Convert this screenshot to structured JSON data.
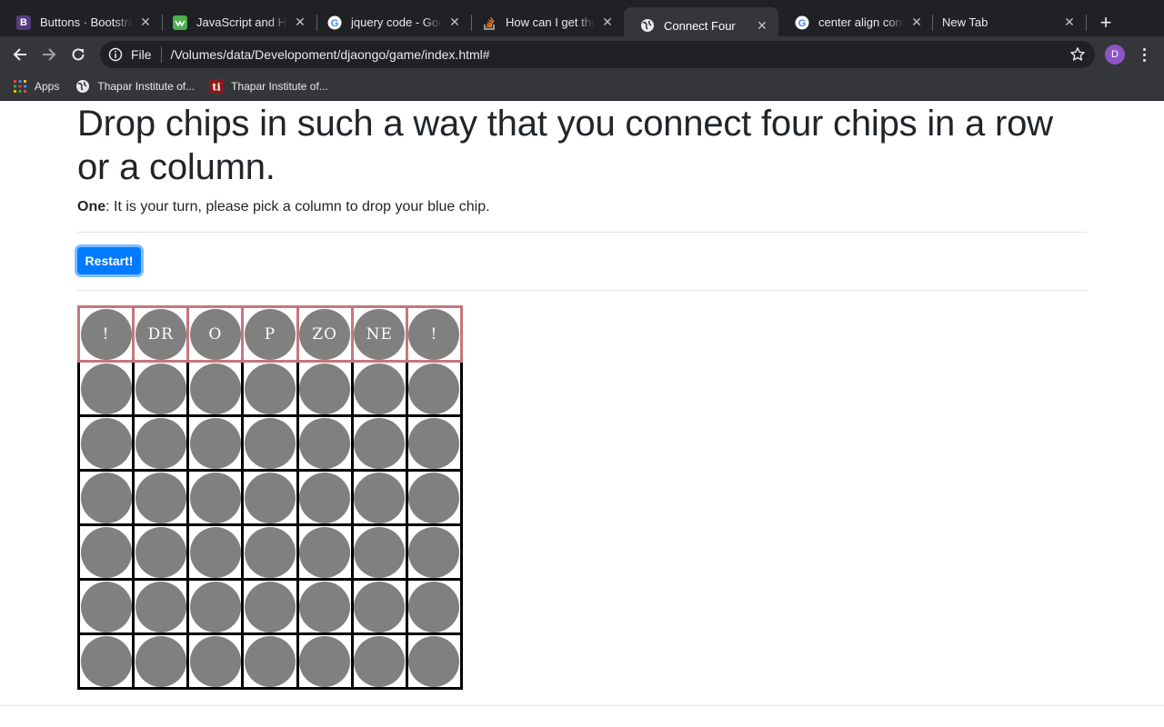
{
  "tabs": [
    {
      "title": "Buttons · Bootstrap",
      "favicon": "bootstrap-icon",
      "color": "#563d7c"
    },
    {
      "title": "JavaScript and HTML",
      "favicon": "w3-icon",
      "color": "#4caf50"
    },
    {
      "title": "jquery code - Google Search",
      "favicon": "google-icon",
      "color": "#4285f4"
    },
    {
      "title": "How can I get the value",
      "favicon": "stackoverflow-icon",
      "color": "#f48024"
    },
    {
      "title": "Connect Four",
      "favicon": "globe-icon",
      "color": "#ffffff"
    },
    {
      "title": "center align container",
      "favicon": "google-icon",
      "color": "#4285f4"
    },
    {
      "title": "New Tab",
      "favicon": "",
      "color": ""
    }
  ],
  "tab_close_glyph": "✕",
  "new_tab_glyph": "+",
  "omnibox": {
    "scheme": "File",
    "url": "/Volumes/data/Developoment/djaongo/game/index.html#"
  },
  "profile": {
    "initial": "D",
    "color": "#8e55c4"
  },
  "bookmarks": [
    {
      "label": "Apps",
      "icon": "apps-grid-icon"
    },
    {
      "label": "Thapar Institute of...",
      "icon": "globe-icon"
    },
    {
      "label": "Thapar Institute of...",
      "icon": "thapar-logo-icon"
    }
  ],
  "page": {
    "heading": "Drop chips in such a way that you connect four chips in a row or a column.",
    "status_player": "One",
    "status_text": ": It is your turn, please pick a column to drop your blue chip.",
    "restart_label": "Restart!",
    "button_color": "#007bff"
  },
  "board": {
    "columns": 7,
    "rows": 6,
    "drop_zone_labels": [
      "!",
      "DR",
      "O",
      "P",
      "ZO",
      "NE",
      "!"
    ],
    "empty_chip_color": "#808080",
    "drop_zone_border_color": "#c6777c"
  }
}
